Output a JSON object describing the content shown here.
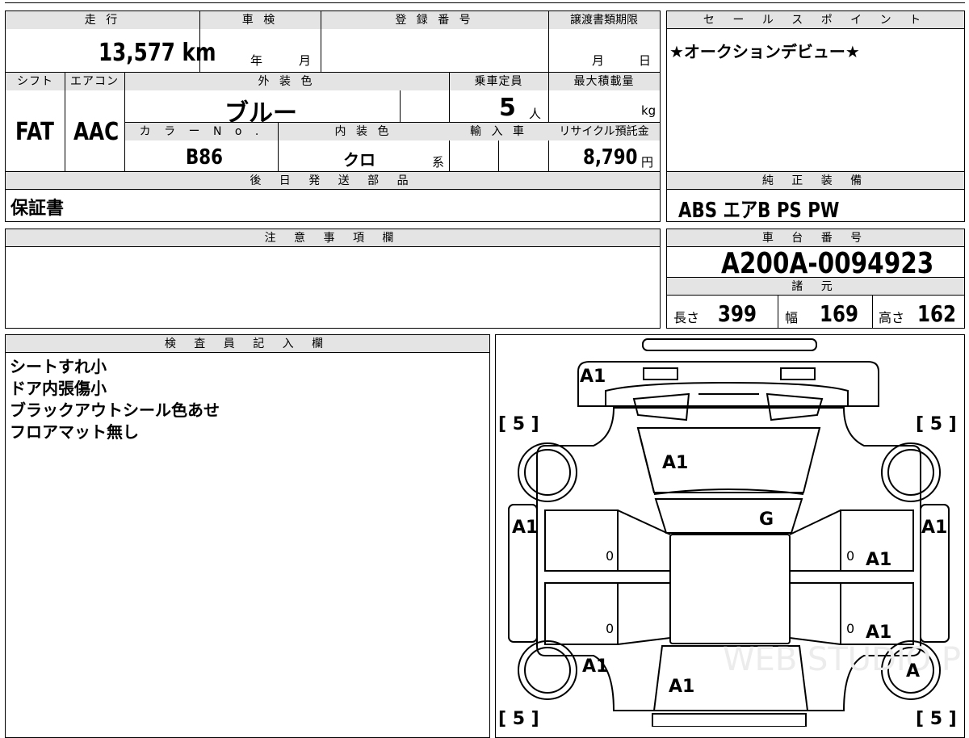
{
  "labels": {
    "mileage": "走 行",
    "shaken": "車 検",
    "reg_number": "登 録 番 号",
    "transfer_deadline": "譲渡書類期限",
    "shift": "シフト",
    "aircon": "エアコン",
    "exterior_color": "外 装 色",
    "capacity": "乗車定員",
    "max_load": "最大積載量",
    "color_no": "カ ラ ー N o .",
    "interior_color": "内 装 色",
    "import": "輸 入 車",
    "recycle_fee": "リサイクル預託金",
    "later_parts": "後 日 発 送 部 品",
    "cautions": "注 意 事 項 欄",
    "sales_points": "セ ー ル ス ポ イ ン ト",
    "std_equipment": "純 正 装 備",
    "chassis_no": "車 台 番 号",
    "specs": "諸 元",
    "inspector_notes": "検 査 員 記 入 欄"
  },
  "units": {
    "year": "年",
    "month": "月",
    "day": "日",
    "person": "人",
    "kg": "kg",
    "yen": "円",
    "kei": "系"
  },
  "values": {
    "mileage": "13,577 km",
    "shift": "FAT",
    "aircon": "AAC",
    "exterior_color": "ブルー",
    "capacity": "5",
    "color_no": "B86",
    "interior_color": "クロ",
    "recycle_fee": "8,790",
    "later_parts": "保証書",
    "sales_point": "★オークションデビュー★",
    "std_equipment": "ABS エアB PS PW",
    "chassis_no": "A200A-0094923"
  },
  "specs": {
    "length_label": "長さ",
    "length": "399",
    "width_label": "幅",
    "width": "169",
    "height_label": "高さ",
    "height": "162"
  },
  "inspector_notes": [
    "シートすれ小",
    "ドア内張傷小",
    "ブラックアウトシール色あせ",
    "フロアマット無し"
  ],
  "diagram": {
    "tire_label": "[ 5 ]",
    "marks": {
      "rear": "A1",
      "roof": "A1",
      "glass": "G",
      "left_quarter": "A1",
      "right_quarter": "A1",
      "right_rear_door": "A1",
      "right_front_door": "A1",
      "left_fender": "A1",
      "bonnet": "A1",
      "right_front_wheel": "A",
      "zero": "0"
    },
    "watermark": "WEB STUDIO PS"
  }
}
